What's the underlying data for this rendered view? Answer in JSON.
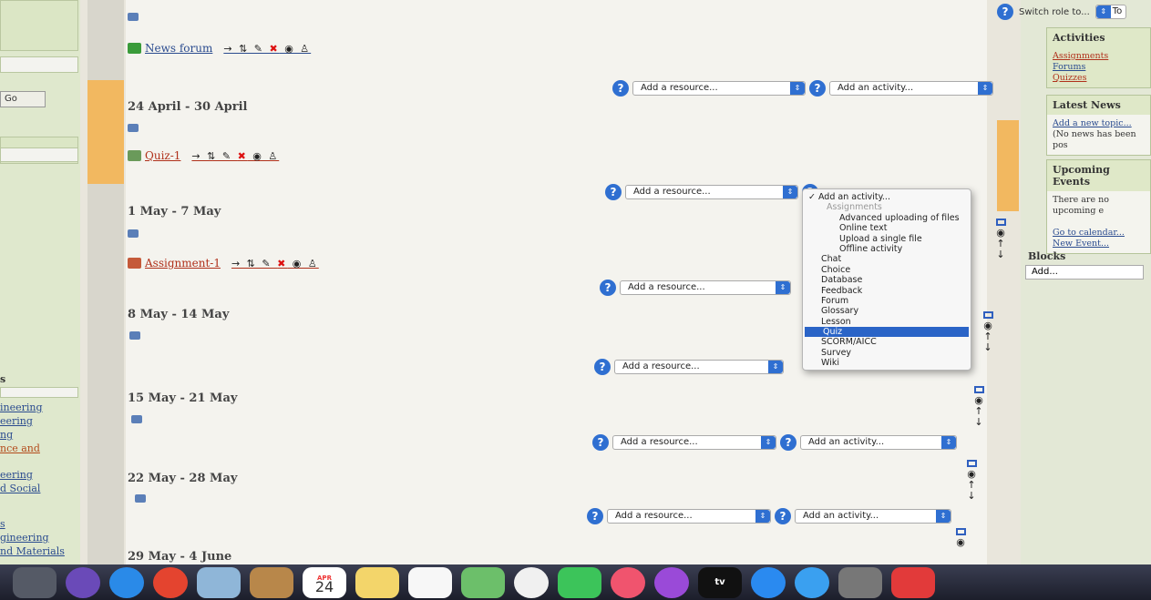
{
  "left": {
    "go_label": "Go",
    "section_head": "s",
    "links": [
      "ineering",
      "eering",
      "ng",
      "nce and",
      "eering",
      "d Social",
      "s",
      "gineering",
      "nd Materials"
    ]
  },
  "news_forum": "News forum",
  "weeks": [
    {
      "title": "24 April - 30 April",
      "activity": "Quiz-1"
    },
    {
      "title": "1 May - 7 May",
      "activity": "Assignment-1"
    },
    {
      "title": "8 May - 14 May"
    },
    {
      "title": "15 May - 21 May"
    },
    {
      "title": "22 May - 28 May"
    },
    {
      "title": "29 May - 4 June"
    }
  ],
  "add_resource": "Add a resource...",
  "add_activity": "Add an activity...",
  "help": "?",
  "dropdown": {
    "selected_label": "✓ Add an activity...",
    "group_label": "Assignments",
    "sub_items": [
      "Advanced uploading of files",
      "Online text",
      "Upload a single file",
      "Offline activity"
    ],
    "items": [
      "Chat",
      "Choice",
      "Database",
      "Feedback",
      "Forum",
      "Glossary",
      "Lesson",
      "Quiz",
      "SCORM/AICC",
      "Survey",
      "Wiki"
    ]
  },
  "right": {
    "switch_role": "Switch role to...",
    "switch_role_tail": "To",
    "activities_head": "Activities",
    "activities": [
      "Assignments",
      "Forums",
      "Quizzes"
    ],
    "news_head": "Latest News",
    "news_link": "Add a new topic...",
    "news_text": "(No news has been pos",
    "events_head": "Upcoming Events",
    "events_text": "There are no upcoming e",
    "calendar_link": "Go to calendar...",
    "new_event_link": "New Event...",
    "blocks_head": "Blocks",
    "blocks_add": "Add..."
  },
  "dock": {
    "cal_month": "APR",
    "cal_day": "24",
    "tv": "tv"
  },
  "colors": {
    "orange": "#f2b860",
    "accent": "#2f6fd1",
    "highlight": "#2a64c7"
  }
}
